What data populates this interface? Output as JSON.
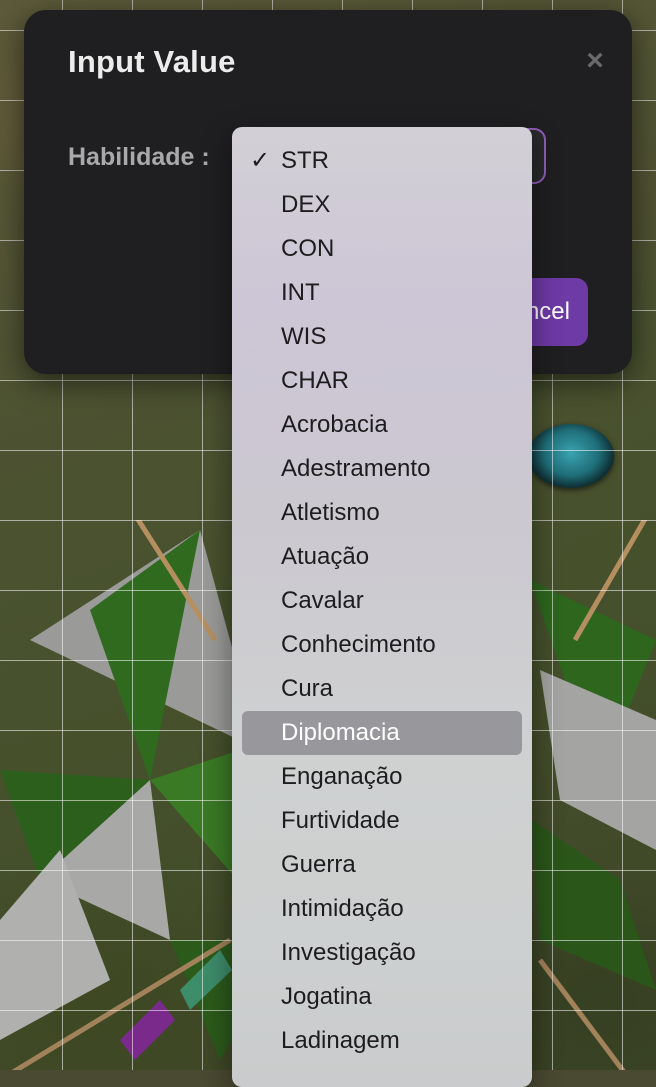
{
  "dialog": {
    "title": "Input Value",
    "close_icon": "close-icon",
    "field_label": "Habilidade :",
    "selected_value": "STR",
    "cancel_label": "Cancel"
  },
  "dropdown": {
    "check_glyph": "✓",
    "selected_index": 0,
    "highlighted_index": 13,
    "options": [
      "STR",
      "DEX",
      "CON",
      "INT",
      "WIS",
      "CHAR",
      "Acrobacia",
      "Adestramento",
      "Atletismo",
      "Atuação",
      "Cavalar",
      "Conhecimento",
      "Cura",
      "Diplomacia",
      "Enganação",
      "Furtividade",
      "Guerra",
      "Intimidação",
      "Investigação",
      "Jogatina",
      "Ladinagem"
    ]
  },
  "colors": {
    "dialog_bg": "#1f1f21",
    "accent": "#6e3aa6",
    "select_border": "#8f5fb8",
    "highlight": "#98989c"
  }
}
